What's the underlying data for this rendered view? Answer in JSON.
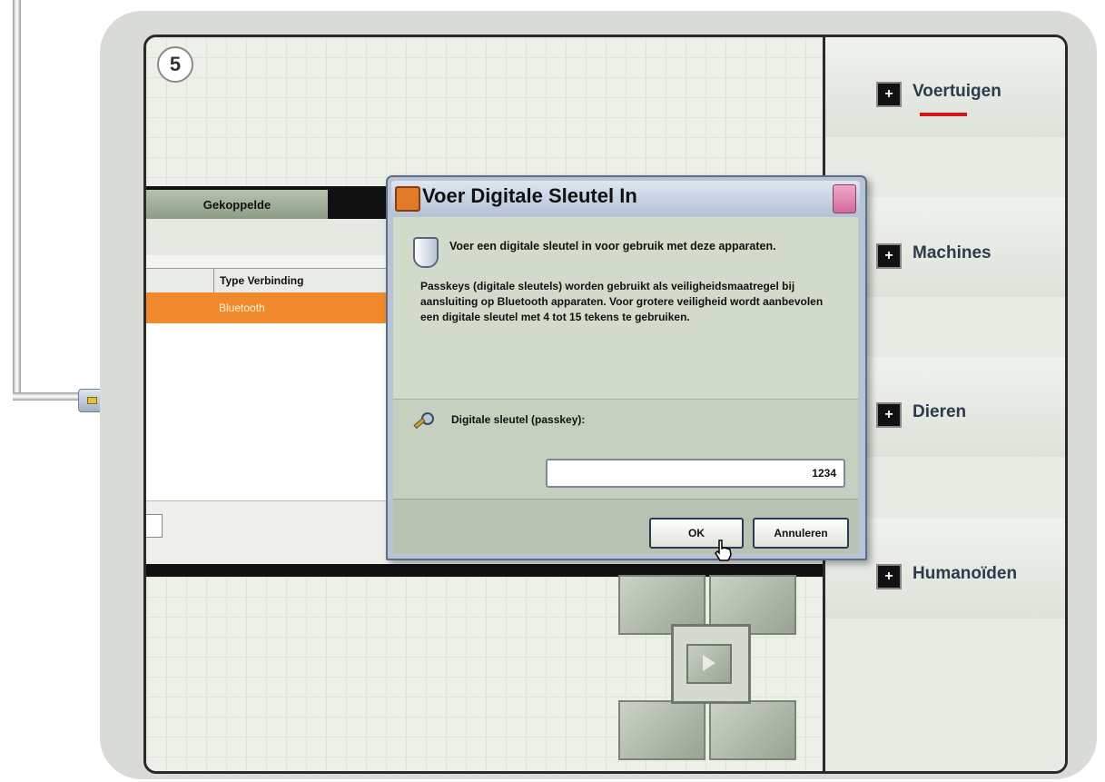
{
  "step": {
    "number": "5"
  },
  "background_app": {
    "tab_label": "Gekoppelde",
    "columns": [
      "",
      "Type Verbinding"
    ],
    "selected_row": {
      "connection": "Bluetooth"
    }
  },
  "dialog": {
    "title": "Voer Digitale Sleutel In",
    "heading": "Voer een digitale sleutel in voor gebruik met deze apparaten.",
    "body": "Passkeys (digitale sleutels) worden gebruikt als veiligheidsmaatregel bij aansluiting op Bluetooth apparaten. Voor grotere veiligheid wordt aanbevolen een digitale sleutel met 4 tot 15 tekens te gebruiken.",
    "field_label": "Digitale sleutel (passkey):",
    "field_value": "1234",
    "ok_label": "OK",
    "cancel_label": "Annuleren"
  },
  "menu": {
    "items": [
      {
        "label": "Voertuigen",
        "icon": "plus-icon"
      },
      {
        "label": "Machines",
        "icon": "plus-icon"
      },
      {
        "label": "Dieren",
        "icon": "plus-icon"
      },
      {
        "label": "Humanoïden",
        "icon": "plus-icon"
      }
    ],
    "active_accent": "#d01818"
  },
  "colors": {
    "selection": "#f08a2c",
    "dialog_title": "#b5c2d6"
  }
}
